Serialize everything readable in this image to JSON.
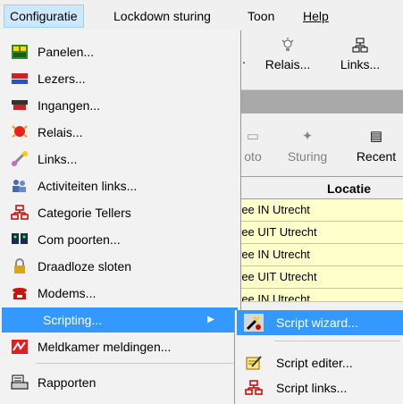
{
  "menubar": [
    {
      "label": "Configuratie",
      "active": true
    },
    {
      "label": "Lockdown sturing",
      "active": false
    },
    {
      "label": "Toon",
      "active": false
    },
    {
      "label": "Help",
      "active": false
    }
  ],
  "toolbar1": {
    "relais": "Relais...",
    "links": "Links..."
  },
  "toolbar2": {
    "foto": "oto",
    "sturing": "Sturing",
    "recent": "Recent"
  },
  "grid": {
    "header": "Locatie",
    "rows": [
      "ree IN Utrecht",
      "ree UIT Utrecht",
      "ree IN Utrecht",
      "ree UIT Utrecht",
      "ree IN Utrecht"
    ]
  },
  "menu": {
    "items": [
      {
        "label": "Panelen...",
        "icon": "panel-icon"
      },
      {
        "label": "Lezers...",
        "icon": "reader-icon"
      },
      {
        "label": "Ingangen...",
        "icon": "input-icon"
      },
      {
        "label": "Relais...",
        "icon": "relay-icon"
      },
      {
        "label": "Links...",
        "icon": "link-icon"
      },
      {
        "label": "Activiteiten links...",
        "icon": "activity-links-icon"
      },
      {
        "label": "Categorie Tellers",
        "icon": "category-counters-icon"
      },
      {
        "label": "Com poorten...",
        "icon": "com-ports-icon"
      },
      {
        "label": "Draadloze sloten",
        "icon": "wireless-lock-icon"
      },
      {
        "label": "Modems...",
        "icon": "modem-icon"
      },
      {
        "label": "Scripting...",
        "icon": ""
      },
      {
        "label": "Meldkamer meldingen...",
        "icon": "alarm-center-icon"
      },
      {
        "label": "Rapporten",
        "icon": "reports-icon"
      }
    ]
  },
  "submenu": {
    "items": [
      {
        "label": "Script wizard...",
        "icon": "script-wizard-icon"
      },
      {
        "label": "Script editer...",
        "icon": "script-editor-icon"
      },
      {
        "label": "Script links...",
        "icon": "script-links-icon"
      }
    ]
  }
}
